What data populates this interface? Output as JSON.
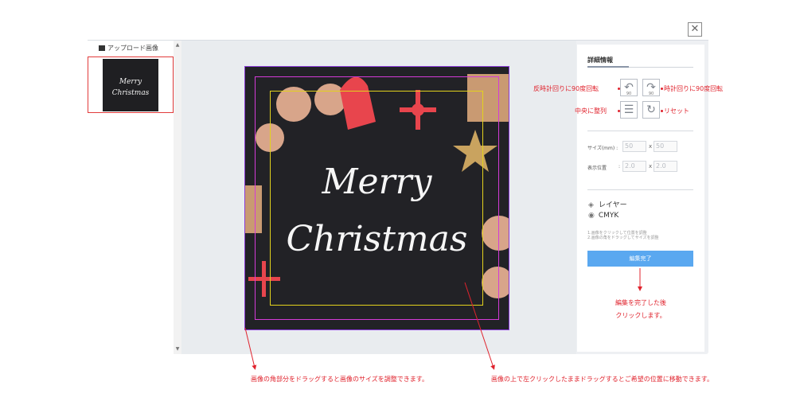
{
  "upload": {
    "title": "アップロード画像",
    "thumb_line1": "Merry",
    "thumb_line2": "Christmas"
  },
  "artwork": {
    "line1": "Merry",
    "line2": "Christmas"
  },
  "panel": {
    "title": "詳細情報",
    "rotate_ccw_value": "90",
    "rotate_cw_value": "90",
    "size_label": "サイズ(mm) :",
    "size_w": "50",
    "size_h": "50",
    "position_label": "表示位置",
    "pos_colon": ":",
    "pos_x": "2.0",
    "pos_y": "2.0",
    "times": "x",
    "layer_label": "レイヤー",
    "cmyk_label": "CMYK",
    "help_line1": "1.画像をクリックして位置を調整",
    "help_line2": "2.画像の角をドラッグしてサイズを調整",
    "done_button": "編集完了"
  },
  "annotations": {
    "rotate_ccw": "反時計回りに90度回転",
    "rotate_cw": "時計回りに90度回転",
    "align_center": "中央に整列",
    "reset": "リセット",
    "after_edit_line1": "編集を完了した後",
    "after_edit_line2": "クリックします。",
    "resize_hint": "画像の角部分をドラッグすると画像のサイズを調整できます。",
    "move_hint": "画像の上で左クリックしたままドラッグするとご希望の位置に移動できます。"
  },
  "colors": {
    "accent_red": "#e0232d",
    "button_blue": "#5aa8f0",
    "guide_magenta": "#d43bd8",
    "guide_yellow": "#e3d21d"
  },
  "icons": [
    "image-icon",
    "close-icon",
    "rotate-ccw-icon",
    "rotate-cw-icon",
    "align-center-icon",
    "reset-icon",
    "layers-icon",
    "eye-icon"
  ]
}
